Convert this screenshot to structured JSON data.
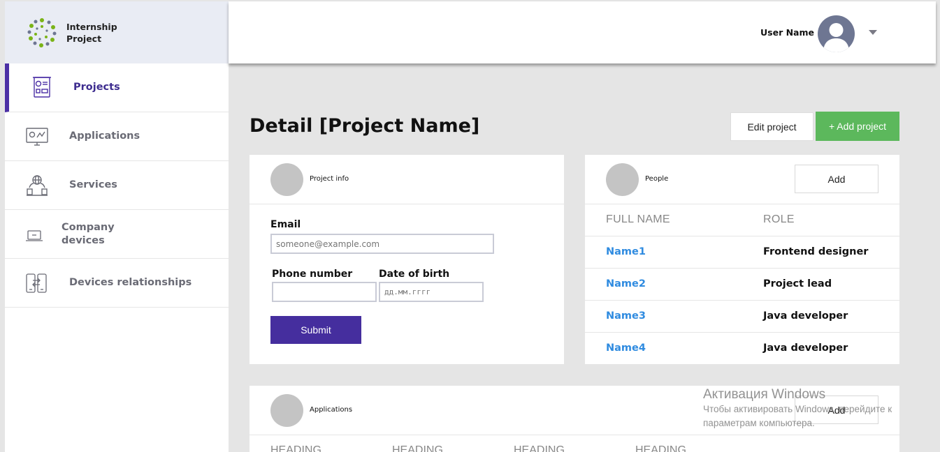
{
  "app": {
    "logo_line1": "Internship",
    "logo_line2": "Project"
  },
  "sidebar": {
    "items": [
      {
        "label": "Projects",
        "icon": "projects-board-icon",
        "active": true
      },
      {
        "label": "Applications",
        "icon": "applications-monitor-icon"
      },
      {
        "label": "Services",
        "icon": "services-globe-icon"
      },
      {
        "label": "Company devices",
        "icon": "company-devices-laptop-icon"
      },
      {
        "label": "Devices relationships",
        "icon": "devices-relationships-icon"
      }
    ]
  },
  "header": {
    "user_name": "User Name"
  },
  "page": {
    "title": "Detail [Project Name]",
    "edit_label": "Edit project",
    "add_label": "+ Add project"
  },
  "project_info": {
    "title": "Project info",
    "email_label": "Email",
    "email_placeholder": "someone@example.com",
    "phone_label": "Phone number",
    "dob_label": "Date of birth",
    "dob_placeholder": "дд.мм.гггг",
    "submit_label": "Submit"
  },
  "people": {
    "title": "People",
    "add_label": "Add",
    "col_name": "FULL NAME",
    "col_role": "ROLE",
    "rows": [
      {
        "name": "Name1",
        "role": "Frontend designer"
      },
      {
        "name": "Name2",
        "role": "Project lead"
      },
      {
        "name": "Name3",
        "role": "Java developer"
      },
      {
        "name": "Name4",
        "role": "Java developer"
      }
    ]
  },
  "applications": {
    "title": "Applications",
    "add_label": "Add",
    "headings": [
      "HEADING",
      "HEADING",
      "HEADING",
      "HEADING"
    ]
  },
  "watermark": {
    "title": "Активация Windows",
    "line1": "Чтобы активировать Windows, перейдите к",
    "line2": "параметрам компьютера."
  },
  "colors": {
    "accent": "#452e9e",
    "success": "#5cb85c",
    "link": "#2f8be0"
  }
}
